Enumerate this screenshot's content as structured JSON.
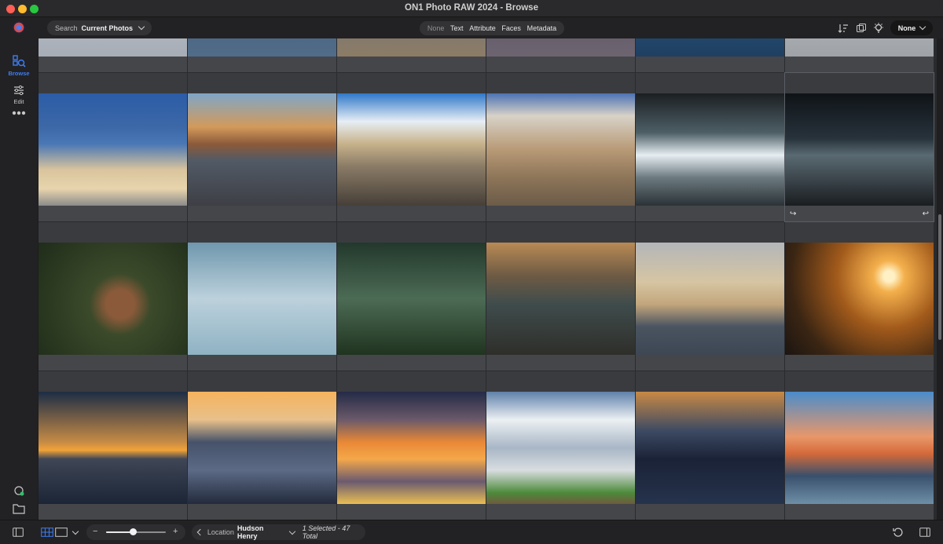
{
  "window": {
    "title": "ON1 Photo RAW 2024 - Browse"
  },
  "toolbar": {
    "search_label": "Search",
    "search_value": "Current Photos",
    "filters": [
      "None",
      "Text",
      "Attribute",
      "Faces",
      "Metadata"
    ],
    "active_filter": "None",
    "preset_value": "None"
  },
  "sidebar": {
    "browse_label": "Browse",
    "edit_label": "Edit",
    "accent_color": "#3d7df5"
  },
  "grid": {
    "selected_index": 11
  },
  "statusbar": {
    "zoom_level": 0.45,
    "zoom_minus": "−",
    "zoom_plus": "+",
    "location_label": "Location",
    "location_value": "Hudson Henry",
    "selection_text": "1 Selected - 47 Total"
  }
}
